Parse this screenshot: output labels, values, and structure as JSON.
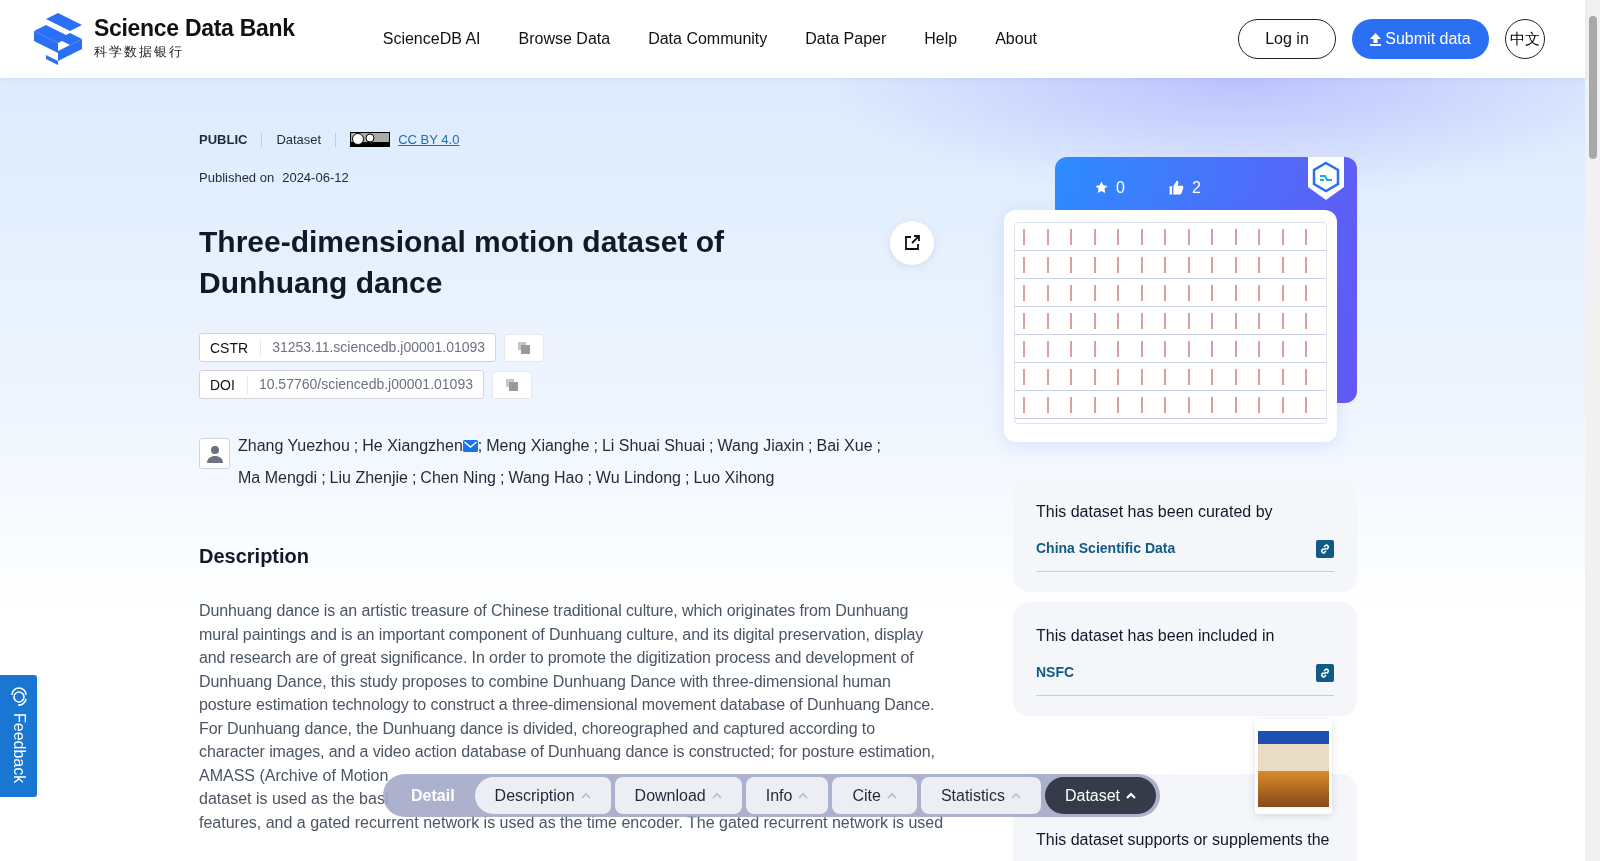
{
  "header": {
    "logo": {
      "title": "Science Data Bank",
      "subtitle": "科学数据银行"
    },
    "nav": [
      {
        "label": "ScienceDB AI"
      },
      {
        "label": "Browse Data"
      },
      {
        "label": "Data Community"
      },
      {
        "label": "Data Paper"
      },
      {
        "label": "Help"
      },
      {
        "label": "About"
      }
    ],
    "login": "Log in",
    "submit": "Submit data",
    "language": "中文"
  },
  "meta": {
    "access": "PUBLIC",
    "type": "Dataset",
    "license": "CC BY 4.0",
    "published_label": "Published on",
    "published_date": "2024-06-12"
  },
  "title": "Three-dimensional motion dataset of Dunhuang dance",
  "identifiers": [
    {
      "label": "CSTR",
      "value": "31253.11.sciencedb.j00001.01093"
    },
    {
      "label": "DOI",
      "value": "10.57760/sciencedb.j00001.01093"
    }
  ],
  "author_separator": ";",
  "authors": [
    {
      "name": "Zhang Yuezhou",
      "email": false
    },
    {
      "name": "He Xiangzhen",
      "email": true
    },
    {
      "name": "Meng Xianghe",
      "email": false
    },
    {
      "name": "Li Shuai Shuai",
      "email": false
    },
    {
      "name": "Wang Jiaxin",
      "email": false
    },
    {
      "name": "Bai Xue",
      "email": false
    },
    {
      "name": "Ma Mengdi",
      "email": false
    },
    {
      "name": "Liu Zhenjie",
      "email": false
    },
    {
      "name": "Chen Ning",
      "email": false
    },
    {
      "name": "Wang Hao",
      "email": false
    },
    {
      "name": "Wu Lindong",
      "email": false
    },
    {
      "name": "Luo Xihong",
      "email": false
    }
  ],
  "description": {
    "heading": "Description",
    "text": "Dunhuang dance is an artistic treasure of Chinese traditional culture, which originates from Dunhuang mural paintings and is an important component of Dunhuang culture, and its digital preservation, display and research are of great significance. In order to promote the digitization process and development of Dunhuang Dance, this study proposes to combine Dunhuang Dance with three-dimensional human posture estimation technology to construct a three-dimensional movement database of Dunhuang Dance. For Dunhuang dance, the Dunhuang dance is divided, choreographed and captured according to character images, and a video action database of Dunhuang dance is constructed; for posture estimation,",
    "partial_lines": [
      "AMASS (Archive of Motion",
      "dataset is used as the basi",
      "features, and a gated recurrent network is used as the time encoder. The gated recurrent network is used"
    ]
  },
  "stats": {
    "favorites": "0",
    "likes": "2"
  },
  "relations": [
    {
      "heading": "This dataset has been curated by",
      "link": "China Scientific Data"
    },
    {
      "heading": "This dataset has been included in",
      "link": "NSFC"
    }
  ],
  "supplement": {
    "text": "This dataset supports or supplements the"
  },
  "feedback": "Feedback",
  "toolbar": {
    "title": "Detail",
    "items": [
      {
        "label": "Description",
        "selected": false
      },
      {
        "label": "Download",
        "selected": false
      },
      {
        "label": "Info",
        "selected": false
      },
      {
        "label": "Cite",
        "selected": false
      },
      {
        "label": "Statistics",
        "selected": false
      },
      {
        "label": "Dataset",
        "selected": true
      }
    ]
  }
}
